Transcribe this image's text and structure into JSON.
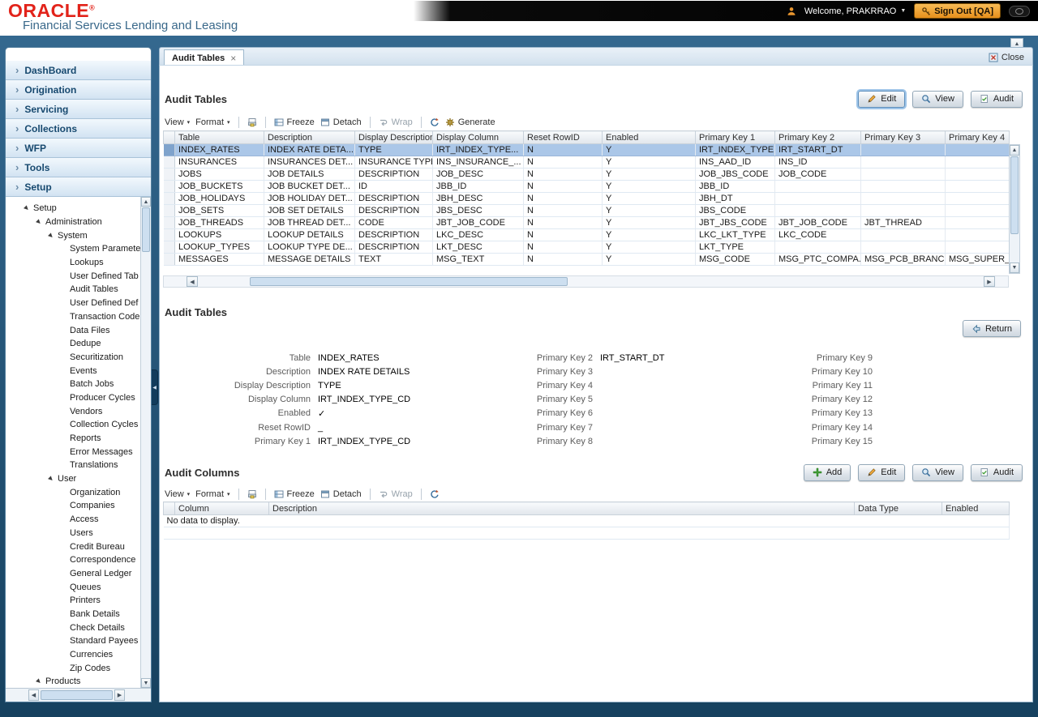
{
  "header": {
    "logo_text": "ORACLE",
    "registered_mark": "®",
    "subtitle": "Financial Services Lending and Leasing",
    "welcome_text": "Welcome, PRAKRRAO",
    "welcome_dropdown_arrow": "▼",
    "sign_out_label": "Sign Out [QA]"
  },
  "icons": {
    "chevron": "›",
    "tree_expanded": "▶",
    "menu_dropdown": "▾",
    "scroll_up": "▲",
    "scroll_down": "▼",
    "scroll_left": "◀",
    "scroll_right": "▶"
  },
  "tabs": {
    "active_tab": "Audit Tables",
    "tab_close": "×",
    "close_label": "Close"
  },
  "sidebar": {
    "accordion": [
      {
        "label": "DashBoard"
      },
      {
        "label": "Origination"
      },
      {
        "label": "Servicing"
      },
      {
        "label": "Collections"
      },
      {
        "label": "WFP"
      },
      {
        "label": "Tools"
      },
      {
        "label": "Setup",
        "active": true
      }
    ],
    "tree": [
      {
        "label": "Setup",
        "level": 0,
        "state": "expanded"
      },
      {
        "label": "Administration",
        "level": 1,
        "state": "expanded"
      },
      {
        "label": "System",
        "level": 2,
        "state": "expanded"
      },
      {
        "label": "System Paramete",
        "level": 3,
        "state": "leaf"
      },
      {
        "label": "Lookups",
        "level": 3,
        "state": "leaf"
      },
      {
        "label": "User Defined Tab",
        "level": 3,
        "state": "leaf"
      },
      {
        "label": "Audit Tables",
        "level": 3,
        "state": "leaf"
      },
      {
        "label": "User Defined Def",
        "level": 3,
        "state": "leaf"
      },
      {
        "label": "Transaction Code",
        "level": 3,
        "state": "leaf"
      },
      {
        "label": "Data Files",
        "level": 3,
        "state": "leaf"
      },
      {
        "label": "Dedupe",
        "level": 3,
        "state": "leaf"
      },
      {
        "label": "Securitization",
        "level": 3,
        "state": "leaf"
      },
      {
        "label": "Events",
        "level": 3,
        "state": "leaf"
      },
      {
        "label": "Batch Jobs",
        "level": 3,
        "state": "leaf"
      },
      {
        "label": "Producer Cycles",
        "level": 3,
        "state": "leaf"
      },
      {
        "label": "Vendors",
        "level": 3,
        "state": "leaf"
      },
      {
        "label": "Collection Cycles",
        "level": 3,
        "state": "leaf"
      },
      {
        "label": "Reports",
        "level": 3,
        "state": "leaf"
      },
      {
        "label": "Error Messages",
        "level": 3,
        "state": "leaf"
      },
      {
        "label": "Translations",
        "level": 3,
        "state": "leaf"
      },
      {
        "label": "User",
        "level": 2,
        "state": "expanded"
      },
      {
        "label": "Organization",
        "level": 3,
        "state": "leaf"
      },
      {
        "label": "Companies",
        "level": 3,
        "state": "leaf"
      },
      {
        "label": "Access",
        "level": 3,
        "state": "leaf"
      },
      {
        "label": "Users",
        "level": 3,
        "state": "leaf"
      },
      {
        "label": "Credit Bureau",
        "level": 3,
        "state": "leaf"
      },
      {
        "label": "Correspondence",
        "level": 3,
        "state": "leaf"
      },
      {
        "label": "General Ledger",
        "level": 3,
        "state": "leaf"
      },
      {
        "label": "Queues",
        "level": 3,
        "state": "leaf"
      },
      {
        "label": "Printers",
        "level": 3,
        "state": "leaf"
      },
      {
        "label": "Bank Details",
        "level": 3,
        "state": "leaf"
      },
      {
        "label": "Check Details",
        "level": 3,
        "state": "leaf"
      },
      {
        "label": "Standard Payees",
        "level": 3,
        "state": "leaf"
      },
      {
        "label": "Currencies",
        "level": 3,
        "state": "leaf"
      },
      {
        "label": "Zip Codes",
        "level": 3,
        "state": "leaf"
      },
      {
        "label": "Products",
        "level": 1,
        "state": "expanded"
      }
    ]
  },
  "audit_tables": {
    "title": "Audit Tables",
    "buttons": {
      "edit": "Edit",
      "view": "View",
      "audit": "Audit"
    },
    "toolbar": {
      "view": "View",
      "format": "Format",
      "freeze": "Freeze",
      "detach": "Detach",
      "wrap": "Wrap",
      "generate": "Generate"
    },
    "columns": [
      "Table",
      "Description",
      "Display Description",
      "Display Column",
      "Reset RowID",
      "Enabled",
      "Primary Key 1",
      "Primary Key 2",
      "Primary Key 3",
      "Primary Key 4"
    ],
    "selected_row": 0,
    "rows": [
      [
        "INDEX_RATES",
        "INDEX RATE DETA...",
        "TYPE",
        "IRT_INDEX_TYPE...",
        "N",
        "Y",
        "IRT_INDEX_TYPE...",
        "IRT_START_DT",
        "",
        ""
      ],
      [
        "INSURANCES",
        "INSURANCES DET...",
        "INSURANCE TYPE",
        "INS_INSURANCE_...",
        "N",
        "Y",
        "INS_AAD_ID",
        "INS_ID",
        "",
        ""
      ],
      [
        "JOBS",
        "JOB DETAILS",
        "DESCRIPTION",
        "JOB_DESC",
        "N",
        "Y",
        "JOB_JBS_CODE",
        "JOB_CODE",
        "",
        ""
      ],
      [
        "JOB_BUCKETS",
        "JOB BUCKET DET...",
        "ID",
        "JBB_ID",
        "N",
        "Y",
        "JBB_ID",
        "",
        "",
        ""
      ],
      [
        "JOB_HOLIDAYS",
        "JOB HOLIDAY DET...",
        "DESCRIPTION",
        "JBH_DESC",
        "N",
        "Y",
        "JBH_DT",
        "",
        "",
        ""
      ],
      [
        "JOB_SETS",
        "JOB SET DETAILS",
        "DESCRIPTION",
        "JBS_DESC",
        "N",
        "Y",
        "JBS_CODE",
        "",
        "",
        ""
      ],
      [
        "JOB_THREADS",
        "JOB THREAD DET...",
        "CODE",
        "JBT_JOB_CODE",
        "N",
        "Y",
        "JBT_JBS_CODE",
        "JBT_JOB_CODE",
        "JBT_THREAD",
        ""
      ],
      [
        "LOOKUPS",
        "LOOKUP DETAILS",
        "DESCRIPTION",
        "LKC_DESC",
        "N",
        "Y",
        "LKC_LKT_TYPE",
        "LKC_CODE",
        "",
        ""
      ],
      [
        "LOOKUP_TYPES",
        "LOOKUP TYPE DE...",
        "DESCRIPTION",
        "LKT_DESC",
        "N",
        "Y",
        "LKT_TYPE",
        "",
        "",
        ""
      ],
      [
        "MESSAGES",
        "MESSAGE DETAILS",
        "TEXT",
        "MSG_TEXT",
        "N",
        "Y",
        "MSG_CODE",
        "MSG_PTC_COMPA...",
        "MSG_PCB_BRANCH",
        "MSG_SUPER_PR..."
      ]
    ]
  },
  "detail": {
    "title": "Audit Tables",
    "return_label": "Return",
    "col1": [
      {
        "label": "Table",
        "value": "INDEX_RATES"
      },
      {
        "label": "Description",
        "value": "INDEX RATE DETAILS"
      },
      {
        "label": "Display Description",
        "value": "TYPE"
      },
      {
        "label": "Display Column",
        "value": "IRT_INDEX_TYPE_CD"
      },
      {
        "label": "Enabled",
        "value": "✓"
      },
      {
        "label": "Reset RowID",
        "value": "_"
      },
      {
        "label": "Primary Key 1",
        "value": "IRT_INDEX_TYPE_CD"
      }
    ],
    "col2": [
      {
        "label": "Primary Key 2",
        "value": "IRT_START_DT"
      },
      {
        "label": "Primary Key 3",
        "value": ""
      },
      {
        "label": "Primary Key 4",
        "value": ""
      },
      {
        "label": "Primary Key 5",
        "value": ""
      },
      {
        "label": "Primary Key 6",
        "value": ""
      },
      {
        "label": "Primary Key 7",
        "value": ""
      },
      {
        "label": "Primary Key 8",
        "value": ""
      }
    ],
    "col3": [
      {
        "label": "Primary Key 9",
        "value": ""
      },
      {
        "label": "Primary Key 10",
        "value": ""
      },
      {
        "label": "Primary Key 11",
        "value": ""
      },
      {
        "label": "Primary Key 12",
        "value": ""
      },
      {
        "label": "Primary Key 13",
        "value": ""
      },
      {
        "label": "Primary Key 14",
        "value": ""
      },
      {
        "label": "Primary Key 15",
        "value": ""
      }
    ]
  },
  "audit_columns": {
    "title": "Audit Columns",
    "buttons": {
      "add": "Add",
      "edit": "Edit",
      "view": "View",
      "audit": "Audit"
    },
    "toolbar": {
      "view": "View",
      "format": "Format",
      "freeze": "Freeze",
      "detach": "Detach",
      "wrap": "Wrap"
    },
    "columns": [
      "Column",
      "Description",
      "Data Type",
      "Enabled"
    ],
    "empty_message": "No data to display."
  }
}
